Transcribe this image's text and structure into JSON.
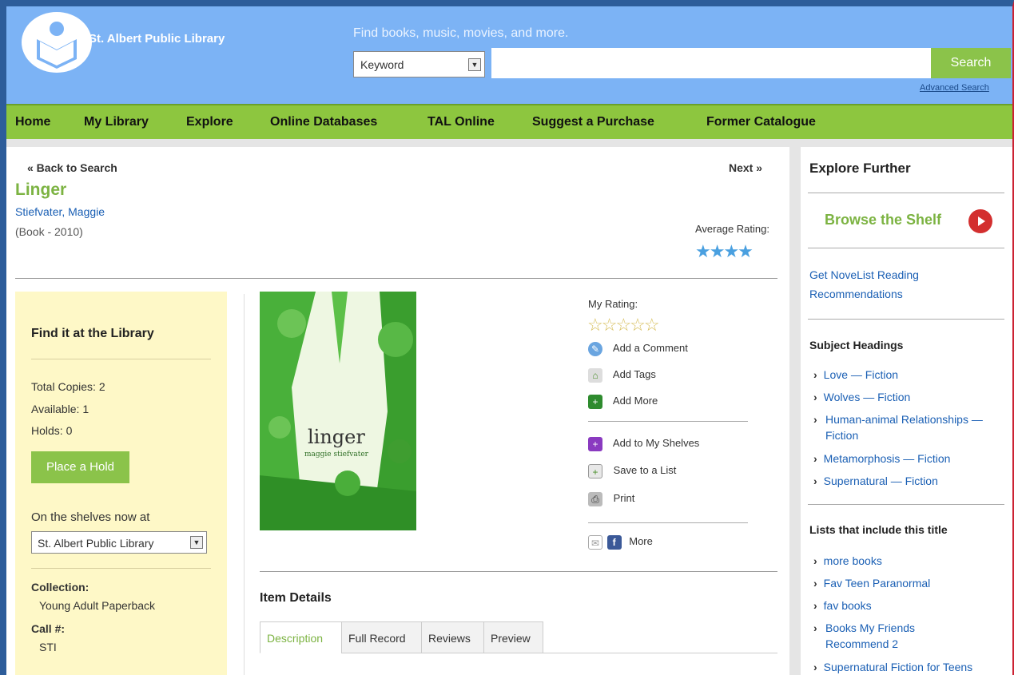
{
  "header": {
    "library_name": "St. Albert Public Library",
    "tagline": "Find books, music, movies, and more.",
    "search_type": "Keyword",
    "search_value": "",
    "search_button": "Search",
    "advanced_search": "Advanced Search"
  },
  "nav": [
    "Home",
    "My Library",
    "Explore",
    "Online Databases",
    "TAL Online",
    "Suggest a Purchase",
    "Former Catalogue"
  ],
  "record": {
    "back": "« Back to Search",
    "next": "Next »",
    "title": "Linger",
    "author": "Stiefvater, Maggie",
    "format": "(Book - 2010)",
    "average_rating_label": "Average Rating:",
    "average_rating_stars": 4
  },
  "availability": {
    "heading": "Find it at the Library",
    "total_copies": "Total Copies: 2",
    "available": "Available: 1",
    "holds": "Holds: 0",
    "hold_button": "Place a Hold",
    "shelves_label": "On the shelves now at",
    "branch": "St. Albert Public Library",
    "collection_label": "Collection:",
    "collection_value": "Young Adult Paperback",
    "call_label": "Call #:",
    "call_value": "STI"
  },
  "cover": {
    "title": "linger",
    "author": "maggie stiefvater"
  },
  "actions": {
    "my_rating_label": "My Rating:",
    "add_comment": "Add a Comment",
    "add_tags": "Add Tags",
    "add_more": "Add More",
    "add_shelves": "Add to My Shelves",
    "save_list": "Save to a List",
    "print": "Print",
    "more": "More"
  },
  "item_details": {
    "heading": "Item Details",
    "tabs": [
      "Description",
      "Full Record",
      "Reviews",
      "Preview"
    ]
  },
  "sidebar": {
    "heading": "Explore Further",
    "browse": "Browse the Shelf",
    "novelist": "Get NoveList Reading Recommendations",
    "subjects_heading": "Subject Headings",
    "subjects": [
      "Love — Fiction",
      "Wolves — Fiction",
      "Human-animal Relationships — Fiction",
      "Metamorphosis — Fiction",
      "Supernatural — Fiction"
    ],
    "lists_heading": "Lists that include this title",
    "lists": [
      "more books",
      "Fav Teen Paranormal",
      "fav books",
      "Books My Friends Recommend 2",
      "Supernatural Fiction for Teens"
    ]
  },
  "colors": {
    "header_blue": "#7cb3f5",
    "nav_green": "#8dc63f",
    "accent_green": "#7cb342",
    "link_blue": "#1a5fb4",
    "panel_yellow": "#fef8c7"
  }
}
